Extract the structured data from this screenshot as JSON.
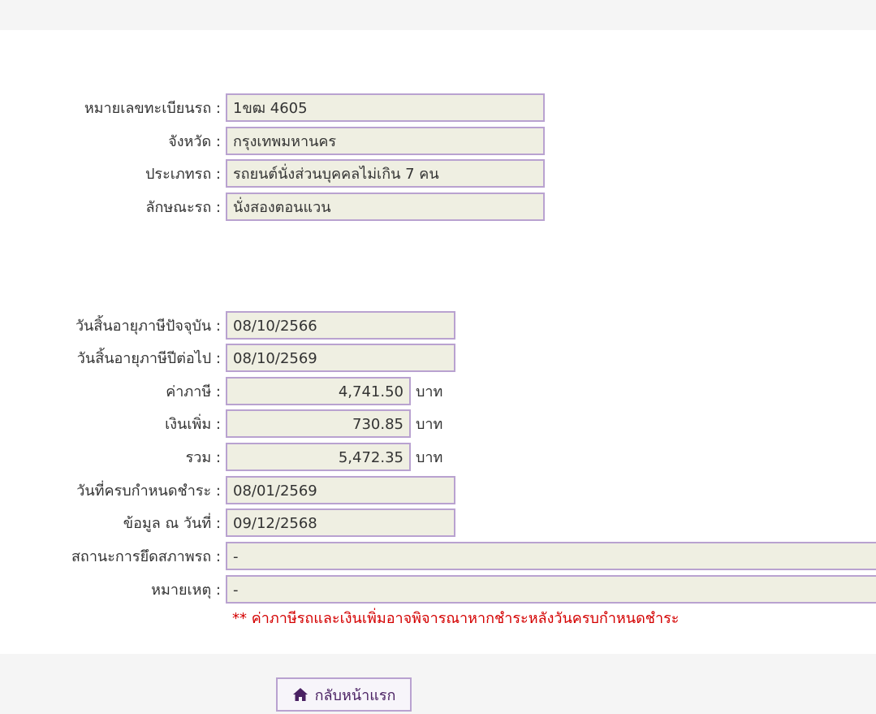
{
  "vehicle": {
    "plate_label": "หมายเลขทะเบียนรถ :",
    "plate_value": "1ขฒ 4605",
    "province_label": "จังหวัด :",
    "province_value": "กรุงเทพมหานคร",
    "type_label": "ประเภทรถ :",
    "type_value": "รถยนต์นั่งส่วนบุคคลไม่เกิน 7 คน",
    "style_label": "ลักษณะรถ :",
    "style_value": "นั่งสองตอนแวน"
  },
  "tax": {
    "current_expiry_label": "วันสิ้นอายุภาษีปัจจุบัน :",
    "current_expiry_value": "08/10/2566",
    "next_expiry_label": "วันสิ้นอายุภาษีปีต่อไป :",
    "next_expiry_value": "08/10/2569",
    "tax_label": "ค่าภาษี :",
    "tax_value": "4,741.50",
    "surcharge_label": "เงินเพิ่ม :",
    "surcharge_value": "730.85",
    "total_label": "รวม :",
    "total_value": "5,472.35",
    "unit": "บาท",
    "due_label": "วันที่ครบกำหนดชำระ :",
    "due_value": "08/01/2569",
    "data_date_label": "ข้อมูล ณ วันที่ :",
    "data_date_value": "09/12/2568",
    "seizure_label": "สถานะการยึดสภาพรถ :",
    "seizure_value": "-",
    "remark_label": "หมายเหตุ :",
    "remark_value": "-",
    "note": "** ค่าภาษีรถและเงินเพิ่มอาจพิจารณาหากชำระหลังวันครบกำหนดชำระ"
  },
  "footer": {
    "home_label": "กลับหน้าแรก",
    "home_icon": "home-icon",
    "accent": "#4a2163"
  }
}
